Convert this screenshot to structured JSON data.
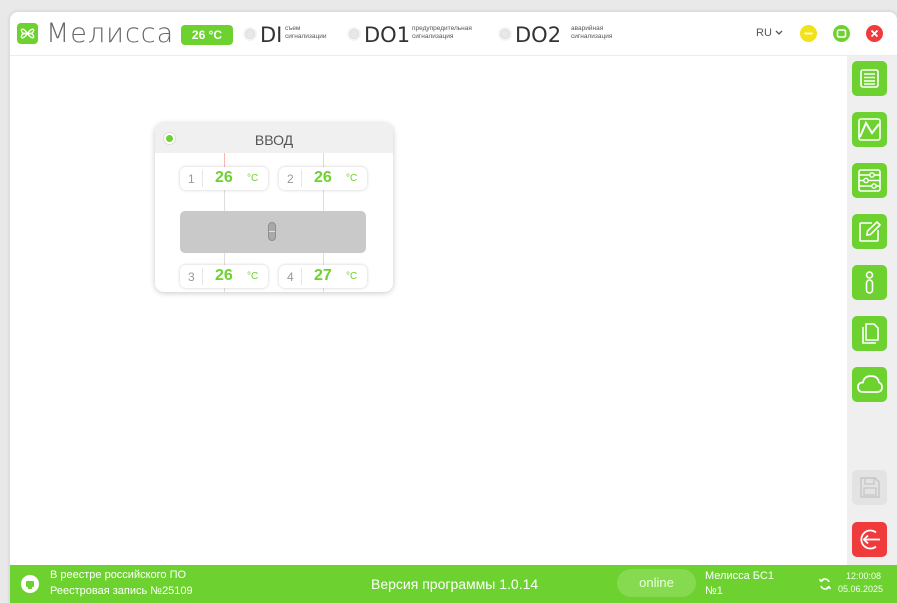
{
  "header": {
    "app_name": "Мелисса",
    "temperature": "26 °C",
    "signals": [
      {
        "code": "DI",
        "desc_line1": "съем",
        "desc_line2": "сигнализации"
      },
      {
        "code": "DO1",
        "desc_line1": "предупредительная",
        "desc_line2": "сигнализация"
      },
      {
        "code": "DO2",
        "desc_line1": "аварийная",
        "desc_line2": "сигнализация"
      }
    ],
    "language": "RU",
    "colors": {
      "accent": "#6dd12f",
      "minimize": "#f2e21a",
      "maximize": "#6dd12f",
      "close": "#ef3b3b"
    }
  },
  "toolbar": {
    "items": [
      {
        "icon": "list-icon"
      },
      {
        "icon": "chart-line-icon"
      },
      {
        "icon": "sliders-icon"
      },
      {
        "icon": "edit-icon"
      },
      {
        "icon": "info-icon"
      },
      {
        "icon": "documents-icon"
      },
      {
        "icon": "cloud-icon"
      },
      {
        "icon": "save-icon",
        "state": "disabled"
      },
      {
        "icon": "exit-icon"
      }
    ]
  },
  "panel": {
    "title": "ВВОД",
    "sensors": [
      {
        "num": "1",
        "value": "26",
        "unit": "°C"
      },
      {
        "num": "2",
        "value": "26",
        "unit": "°C"
      },
      {
        "num": "3",
        "value": "26",
        "unit": "°C"
      },
      {
        "num": "4",
        "value": "27",
        "unit": "°C"
      }
    ]
  },
  "footer": {
    "registry_line1": "В реестре российского ПО",
    "registry_line2": "Реестровая запись №25109",
    "version": "Версия программы  1.0.14",
    "status": "online",
    "device_line1": "Мелисса БС1",
    "device_line2": "№1",
    "time": "12:00:08",
    "date": "05.06.2025"
  }
}
